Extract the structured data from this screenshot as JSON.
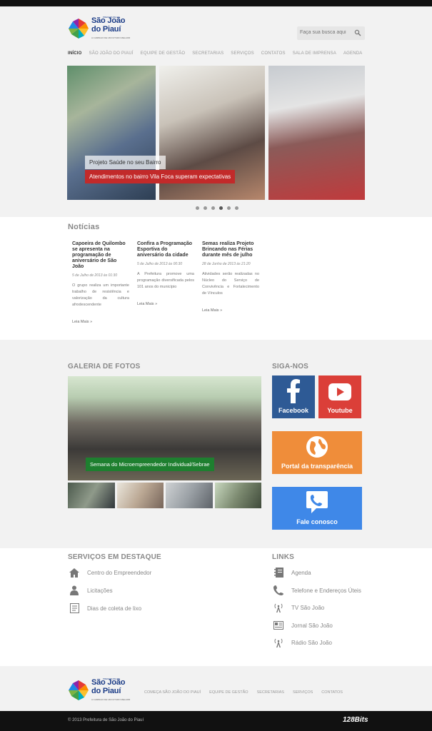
{
  "header": {
    "logo": {
      "line1": "São João",
      "line2": "do Piauí",
      "prefix": "PREFEITURA DE",
      "tagline": "A CAMINHO DE UM FUTURO MELHOR"
    },
    "search_placeholder": "Faça sua busca aqui",
    "nav": [
      "INÍCIO",
      "SÃO JOÃO DO PIAUÍ",
      "EQUIPE DE GESTÃO",
      "SECRETARIAS",
      "SERVIÇOS",
      "CONTATOS",
      "SALA DE IMPRENSA",
      "AGENDA"
    ]
  },
  "slider": {
    "caption_title": "Projeto Saúde no seu Bairro",
    "caption_text": "Atendimentos no bairro Vila Foca superam expectativas",
    "dots": 6,
    "active_dot": 4
  },
  "news": {
    "title": "Notícias",
    "items": [
      {
        "title": "Capoeira de Quilombo se apresenta na programação de aniversário de São João",
        "date": "5 de Julho de 2013 às 01:30",
        "excerpt": "O grupo realiza um importante trabalho de resistência e valorização da cultura afrodescendente",
        "more": "Leia Mais »"
      },
      {
        "title": "Confira a Programação Esportiva do aniversário da cidade",
        "date": "5 de Julho de 2013 às 00:30",
        "excerpt": "A Prefeitura promove uma programação diversificada pelos 101 anos do município",
        "more": "Leia Mais »"
      },
      {
        "title": "Semas realiza Projeto Brincando nas Férias durante mês de julho",
        "date": "28 de Junho de 2013 às 21:20",
        "excerpt": "Atividades serão realizadas no Núcleo do Serviço de Convivência e Fortalecimento de Vínculos",
        "more": "Leia Mais »"
      }
    ]
  },
  "gallery": {
    "title": "GALERIA DE FOTOS",
    "caption": "Semana do Microempreendedor Individual/Sebrae"
  },
  "social": {
    "title": "SIGA-NOS",
    "facebook": "Facebook",
    "youtube": "Youtube",
    "portal": "Portal da transparência",
    "contact": "Fale conosco"
  },
  "services": {
    "title": "SERVIÇOS EM DESTAQUE",
    "items": [
      "Centro do Empreendedor",
      "Licitações",
      "Dias de coleta de lixo"
    ]
  },
  "links": {
    "title": "LINKS",
    "items": [
      "Agenda",
      "Telefone e Endereços Úteis",
      "TV São João",
      "Jornal São João",
      "Rádio São João"
    ]
  },
  "footer": {
    "nav": [
      "COMEÇA SÃO JOÃO DO PIAUÍ",
      "EQUIPE DE GESTÃO",
      "SECRETARIAS",
      "SERVIÇOS",
      "CONTATOS"
    ],
    "copyright": "© 2013 Prefeitura de São João do Piauí",
    "brand": "128Bits"
  }
}
